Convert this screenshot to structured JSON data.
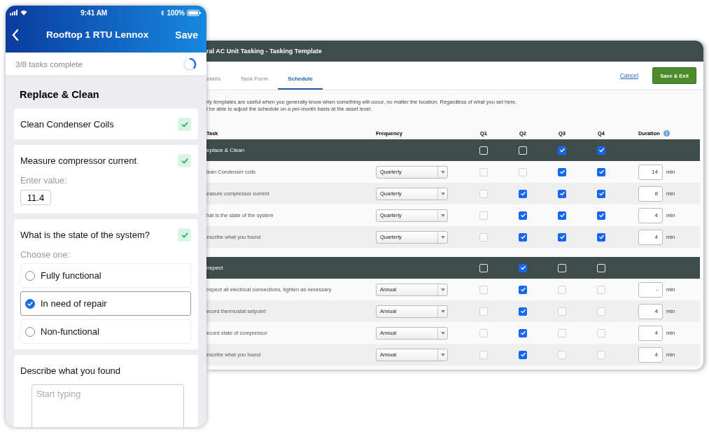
{
  "phone": {
    "status": {
      "time": "9:41 AM",
      "battery": "100%"
    },
    "title": "Rooftop 1 RTU Lennox",
    "save": "Save",
    "progress": {
      "text": "3/8 tasks complete",
      "level": 0.375
    },
    "section_title": "Replace & Clean",
    "tasks": [
      {
        "kind": "check",
        "label": "Clean Condenser Coils",
        "done": true
      },
      {
        "kind": "value",
        "label": "Measure compressor current",
        "done": true,
        "prompt": "Enter value:",
        "value": "11.4"
      },
      {
        "kind": "choice",
        "label": "What is the state of the system?",
        "done": true,
        "prompt": "Choose one:",
        "options": [
          {
            "label": "Fully functional",
            "selected": false
          },
          {
            "label": "In need of repair",
            "selected": true
          },
          {
            "label": "Non-functional",
            "selected": false
          }
        ]
      },
      {
        "kind": "text",
        "label": "Describe what you found",
        "placeholder": "Start typing"
      }
    ]
  },
  "desktop": {
    "title": "ral AC Unit Tasking - Tasking Template",
    "tabs": [
      {
        "label": "etails",
        "selected": false
      },
      {
        "label": "Task Form",
        "selected": false
      },
      {
        "label": "Schedule",
        "selected": true
      }
    ],
    "cancel": "Cancel",
    "save_exit": "Save & Exit",
    "description": [
      "rly templates are useful when you generally know when something will occur, no matter the location.  Regardless of what you set here,",
      "l be able to adjust the schedule on a per-month basis at the asset level."
    ],
    "columns": [
      "Task",
      "Frequency",
      "Q1",
      "Q2",
      "Q3",
      "Q4",
      "Duration"
    ],
    "groups": [
      {
        "name": "eplace & Clean",
        "quarters": [
          false,
          false,
          true,
          true
        ],
        "tasks": [
          {
            "name": "lean Condenser coils",
            "frequency": "Quarterly",
            "quarters": [
              false,
              false,
              true,
              true
            ],
            "duration": "14",
            "unit": "min"
          },
          {
            "name": "easure compressor current",
            "frequency": "Quarterly",
            "quarters": [
              false,
              true,
              true,
              true
            ],
            "duration": "8",
            "unit": "min"
          },
          {
            "name": "hat is the state of the system",
            "frequency": "Quarterly",
            "quarters": [
              false,
              true,
              true,
              true
            ],
            "duration": "4",
            "unit": "min"
          },
          {
            "name": "escribe what you found",
            "frequency": "Quarterly",
            "quarters": [
              false,
              true,
              true,
              true
            ],
            "duration": "4",
            "unit": "min"
          }
        ]
      },
      {
        "name": "nspect",
        "quarters": [
          false,
          true,
          false,
          false
        ],
        "tasks": [
          {
            "name": "nspect all electrical connections, tighten as necessary",
            "frequency": "Annual",
            "quarters": [
              false,
              true,
              false,
              false
            ],
            "duration": "-",
            "unit": "min"
          },
          {
            "name": "ecord thermostat setpoint",
            "frequency": "Annual",
            "quarters": [
              false,
              true,
              false,
              false
            ],
            "duration": "4",
            "unit": "min"
          },
          {
            "name": "ecord state of compressor",
            "frequency": "Annual",
            "quarters": [
              false,
              true,
              false,
              false
            ],
            "duration": "4",
            "unit": "min"
          },
          {
            "name": "escribe what you found",
            "frequency": "Annual",
            "quarters": [
              false,
              true,
              false,
              false
            ],
            "duration": "4",
            "unit": "min"
          }
        ]
      }
    ]
  }
}
